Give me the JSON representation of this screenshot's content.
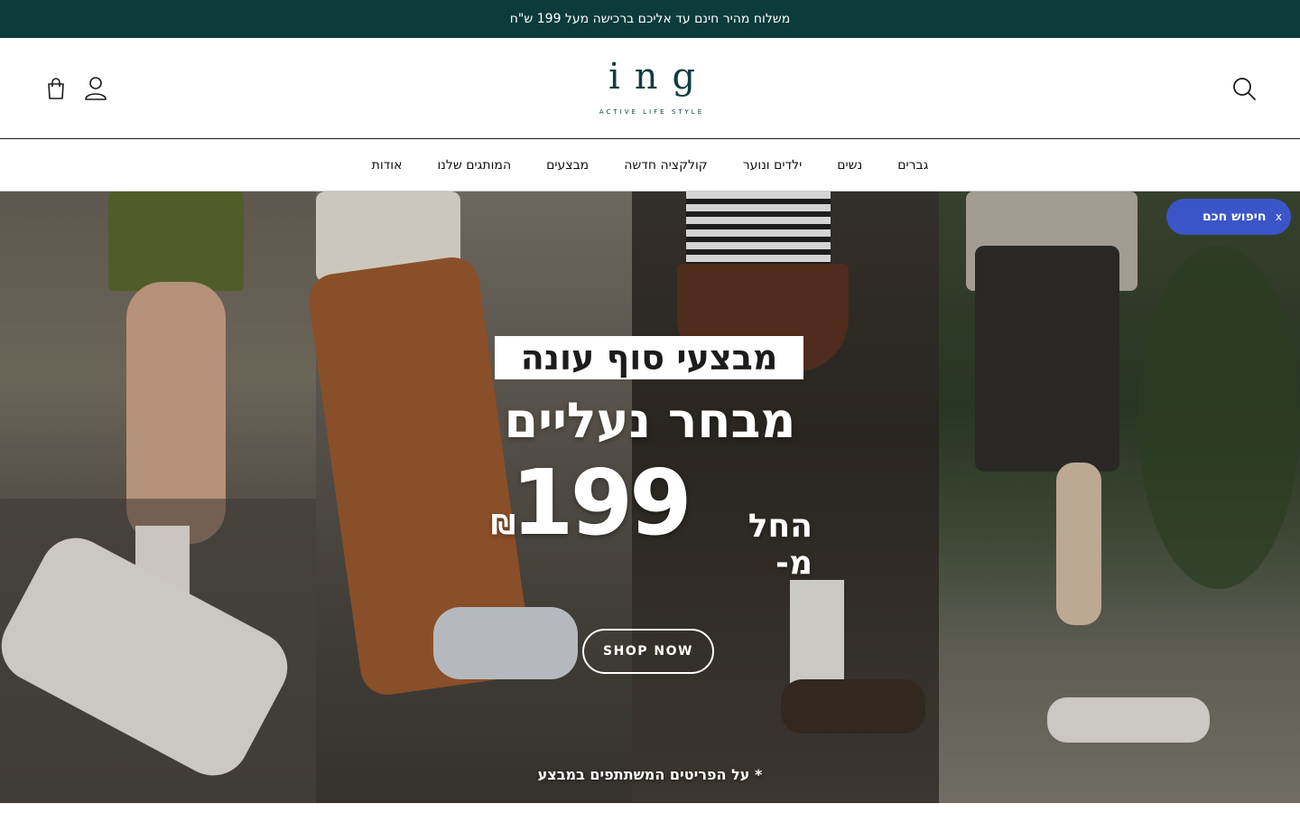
{
  "announcement": {
    "text": "משלוח מהיר חינם עד אליכם ברכישה מעל 199 ש\"ח"
  },
  "header": {
    "logo_main": "ing",
    "logo_sub": "ACTIVE LIFE STYLE",
    "icons": {
      "search": "search-icon",
      "account": "user-icon",
      "cart": "shopping-bag-icon"
    }
  },
  "nav": {
    "items": [
      {
        "label": "גברים"
      },
      {
        "label": "נשים"
      },
      {
        "label": "ילדים ונוער"
      },
      {
        "label": "קולקציה חדשה"
      },
      {
        "label": "מבצעים"
      },
      {
        "label": "המותגים שלנו"
      },
      {
        "label": "אודות"
      }
    ]
  },
  "smart_search": {
    "label": "חיפוש חכם",
    "close": "x"
  },
  "hero": {
    "badge": "מבצעי סוף עונה",
    "headline": "מבחר נעליים",
    "price_prefix": "החל מ-",
    "price": "199",
    "currency": "₪",
    "cta": "SHOP NOW",
    "footnote": "* על הפריטים המשתתפים במבצע"
  },
  "colors": {
    "announcement_bg": "#0c3b3c",
    "brand": "#123c3d",
    "chip": "#3b55c8"
  }
}
